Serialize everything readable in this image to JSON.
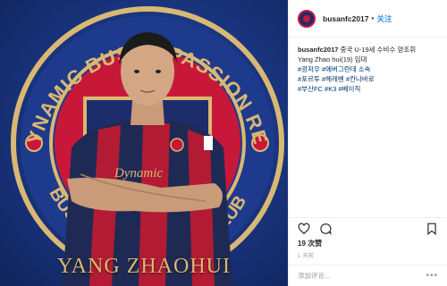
{
  "photo": {
    "emblem_top_text": "DYNAMIC BUSAN PASSION RED",
    "emblem_bottom_left": "BUSAN",
    "emblem_bottom_right": "L CLUB",
    "jersey_text": "Dynamic",
    "caption": "YANG ZHAOHUI",
    "colors": {
      "background": "#1b3885",
      "emblem_red": "#c8183a",
      "gold": "#d9b873",
      "jersey_navy": "#1f2a54"
    }
  },
  "post": {
    "username": "busanfc2017",
    "separator": "•",
    "follow_label": "关注",
    "caption_user": "busanfc2017",
    "caption_text": " 중국 U-19세 수비수 양조휘",
    "caption_line2": "Yang Zhao hui(19) 임대",
    "hashtags": [
      "#광저우 #에버그란데 소속",
      "#포르투 #헤레벤 #칸나바로",
      "#부산FC #K3 #베이직"
    ],
    "likes": "19 次赞",
    "time_ago": "1 天前",
    "comment_placeholder": "添加评论...",
    "more_label": "•••"
  },
  "icons": [
    "heart-icon",
    "comment-icon",
    "bookmark-icon"
  ]
}
